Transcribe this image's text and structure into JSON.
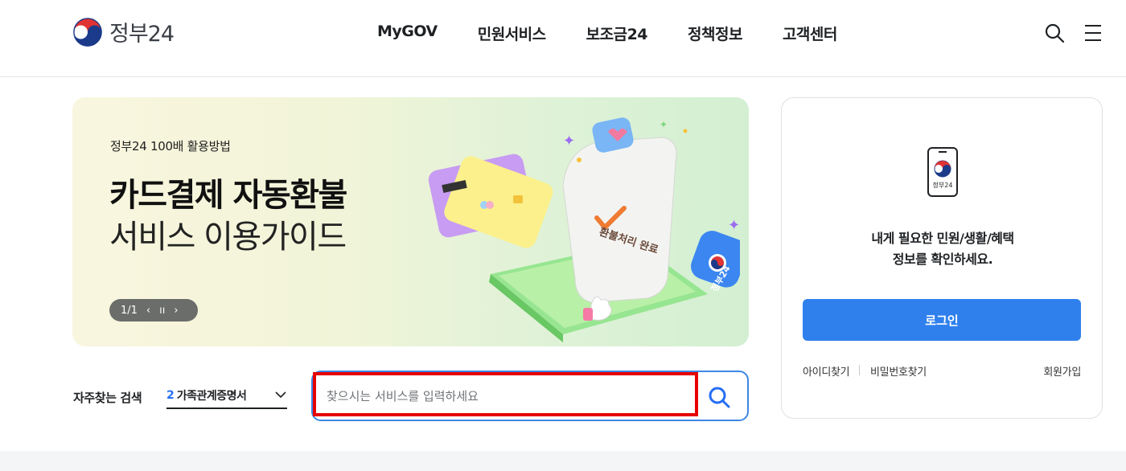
{
  "header": {
    "logo_text": "정부24",
    "nav": [
      "MyGOV",
      "민원서비스",
      "보조금24",
      "정책정보",
      "고객센터"
    ]
  },
  "banner": {
    "subtitle": "정부24 100배 활용방법",
    "title_bold": "카드결제 자동환불",
    "title_regular": "서비스 이용가이드",
    "pager": "1/1",
    "art_receipt_text": "환불처리 완료",
    "art_badge_text": "정부24"
  },
  "search": {
    "freq_label": "자주찾는 검색",
    "freq_rank": "2",
    "freq_item": "가족관계증명서",
    "placeholder": "찾으시는 서비스를 입력하세요"
  },
  "login": {
    "phone_label": "정부24",
    "message_line1": "내게 필요한 민원/생활/혜택",
    "message_line2": "정보를 확인하세요.",
    "button": "로그인",
    "find_id": "아이디찾기",
    "find_pw": "비밀번호찾기",
    "signup": "회원가입"
  },
  "colors": {
    "accent": "#256ef4",
    "login_button": "#2f80ed",
    "highlight": "#e60000"
  }
}
